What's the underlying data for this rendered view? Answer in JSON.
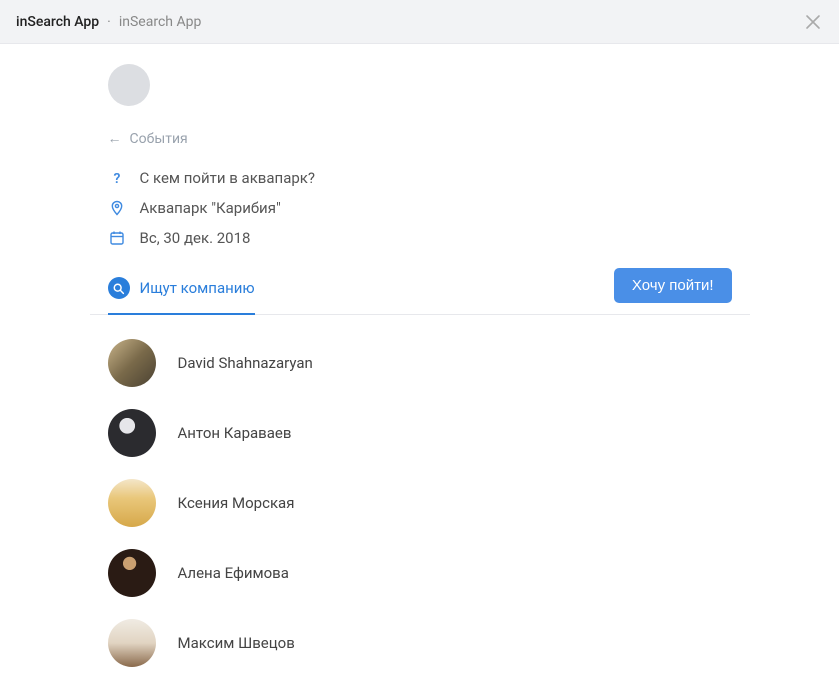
{
  "header": {
    "title_primary": "inSearch App",
    "title_secondary": "inSearch App"
  },
  "back": {
    "label": "События"
  },
  "event": {
    "question": "С кем пойти в аквапарк?",
    "location": "Аквапарк \"Карибия\"",
    "date": "Вс, 30 дек. 2018"
  },
  "tabs": {
    "looking": "Ищут компанию"
  },
  "actions": {
    "want_go": "Хочу пойти!"
  },
  "people": [
    {
      "name": "David Shahnazaryan"
    },
    {
      "name": "Антон Караваев"
    },
    {
      "name": "Ксения Морская"
    },
    {
      "name": "Алена Ефимова"
    },
    {
      "name": "Максим Швецов"
    }
  ]
}
